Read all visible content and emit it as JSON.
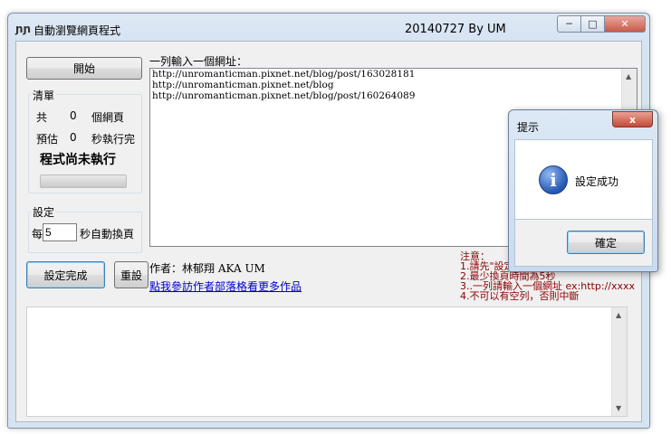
{
  "window": {
    "title": "自動瀏覽網頁程式",
    "version": "20140727    By UM",
    "icon_glyph": "ɲɲ"
  },
  "left": {
    "start_button": "開始",
    "list_group": {
      "label": "清單",
      "total_prefix": "共",
      "total_count": "0",
      "total_suffix": "個網頁",
      "est_prefix": "預估",
      "est_seconds": "0",
      "est_suffix": "秒執行完"
    },
    "status": "程式尚未執行",
    "progress": 0,
    "settings_group": {
      "label": "設定",
      "prefix": "每",
      "interval_value": "5",
      "suffix": "秒自動換頁"
    },
    "done_button": "設定完成",
    "reset_button": "重設"
  },
  "main": {
    "url_label": "一列輸入一個網址：",
    "urls": [
      "http://unromanticman.pixnet.net/blog/post/163028181",
      "http://unromanticman.pixnet.net/blog",
      "http://unromanticman.pixnet.net/blog/post/160264089"
    ],
    "author": "作者：林郁翔 AKA UM",
    "link": "點我參訪作者部落格看更多作品",
    "notes": [
      "注意：",
      "1.請先\"設定",
      "2.最少換頁時間為5秒",
      "3..一列請輸入一個網址 ex:http://xxxx",
      "4.不可以有空列，否則中斷"
    ]
  },
  "dialog": {
    "title": "提示",
    "close_glyph": "x",
    "message": "設定成功",
    "ok_button": "確定",
    "icon_glyph": "i"
  },
  "colors": {
    "notes": "#8b0000",
    "link": "#0000cc",
    "accent_border": "#3c7fb1"
  }
}
